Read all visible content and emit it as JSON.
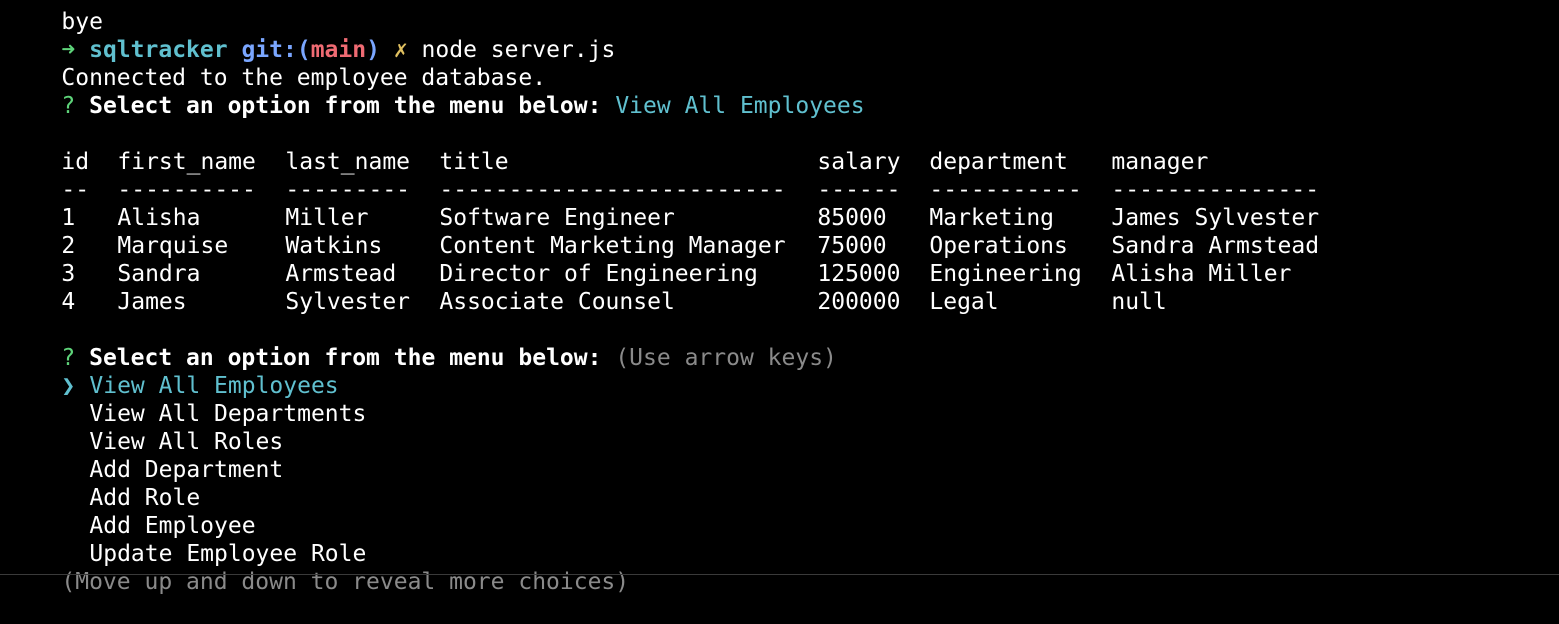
{
  "terminal": {
    "prev_line": "bye",
    "prompt": {
      "arrow": "➜",
      "dir": "sqltracker",
      "git_prefix": "git:(",
      "branch": "main",
      "git_suffix": ")",
      "dirty_mark": "✗",
      "command": "node server.js"
    },
    "connected_msg": "Connected to the employee database.",
    "question_mark": "?",
    "question_text": "Select an option from the menu below:",
    "first_answer": "View All Employees",
    "table": {
      "headers": [
        "id",
        "first_name",
        "last_name",
        "title",
        "salary",
        "department",
        "manager"
      ],
      "separators": [
        "--",
        "----------",
        "---------",
        "-------------------------",
        "------",
        "-----------",
        "---------------"
      ],
      "rows": [
        [
          "1",
          "Alisha",
          "Miller",
          "Software Engineer",
          "85000",
          "Marketing",
          "James Sylvester"
        ],
        [
          "2",
          "Marquise",
          "Watkins",
          "Content Marketing Manager",
          "75000",
          "Operations",
          "Sandra Armstead"
        ],
        [
          "3",
          "Sandra",
          "Armstead",
          "Director of Engineering",
          "125000",
          "Engineering",
          "Alisha Miller"
        ],
        [
          "4",
          "James",
          "Sylvester",
          "Associate Counsel",
          "200000",
          "Legal",
          "null"
        ]
      ]
    },
    "hint": "(Use arrow keys)",
    "pointer": "❯",
    "menu": [
      "View All Employees",
      "View All Departments",
      "View All Roles",
      "Add Department",
      "Add Role",
      "Add Employee",
      "Update Employee Role"
    ],
    "footer_hint": "(Move up and down to reveal more choices)"
  },
  "colors": {
    "background": "#000000",
    "text": "#ffffff",
    "green": "#5ed47a",
    "cyan": "#60c0cf",
    "blue": "#7aa6ff",
    "red": "#ef6b73",
    "yellow": "#e0c060",
    "dim": "#8a8a8a"
  }
}
